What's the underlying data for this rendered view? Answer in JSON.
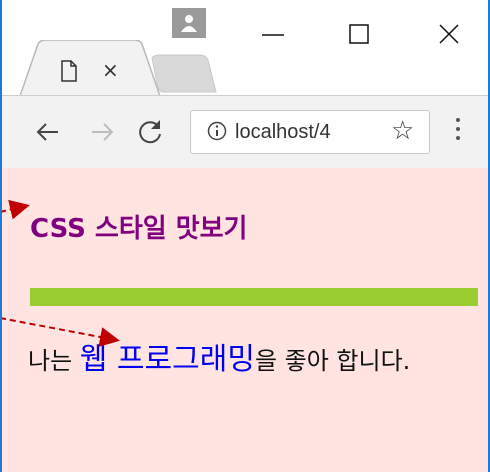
{
  "window": {
    "profile_icon": "person-icon",
    "minimize_icon": "minimize-icon",
    "maximize_icon": "maximize-icon",
    "close_icon": "close-icon"
  },
  "tab": {
    "icon": "page-icon",
    "close_label": "×"
  },
  "toolbar": {
    "back_icon": "back-arrow-icon",
    "forward_icon": "forward-arrow-icon",
    "reload_icon": "reload-icon",
    "url": "localhost/4",
    "star_label": "☆",
    "menu_icon": "more-vert-icon"
  },
  "page": {
    "background": "#ffe4e1",
    "heading": "CSS 스타일 맛보기",
    "heading_color": "#800080",
    "bar_color": "#9acd32",
    "para_before": "나는 ",
    "para_highlight": "웹 프로그래밍",
    "para_after": "을 좋아 합니다.",
    "highlight_color": "#0000ee",
    "annotation_color": "#c00000"
  }
}
